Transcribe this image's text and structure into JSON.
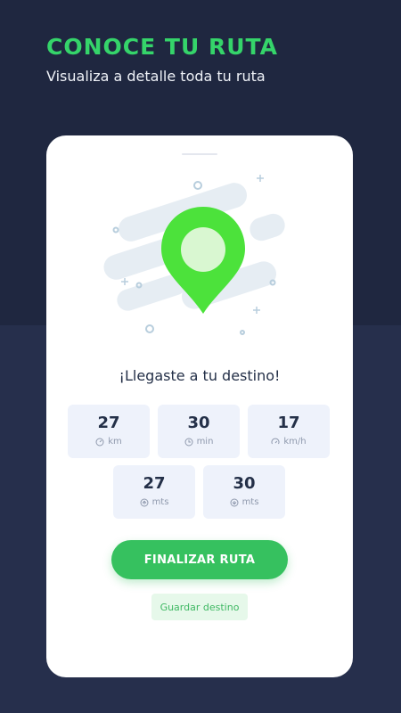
{
  "header": {
    "title": "CONOCE TU RUTA",
    "subtitle": "Visualiza a detalle toda tu ruta"
  },
  "card": {
    "message": "¡Llegaste a tu destino!",
    "stats_row1": [
      {
        "value": "27",
        "unit": "km",
        "icon": "gauge-icon"
      },
      {
        "value": "30",
        "unit": "min",
        "icon": "clock-icon"
      },
      {
        "value": "17",
        "unit": "km/h",
        "icon": "speedometer-icon"
      }
    ],
    "stats_row2": [
      {
        "value": "27",
        "unit": "mts",
        "icon": "arrow-up-icon"
      },
      {
        "value": "30",
        "unit": "mts",
        "icon": "arrow-down-icon"
      }
    ],
    "finish_label": "FINALIZAR RUTA",
    "save_label": "Guardar destino"
  },
  "colors": {
    "background": "#1f2740",
    "accent": "#35d46a",
    "pin": "#4ce23b",
    "button": "#36c15f"
  }
}
